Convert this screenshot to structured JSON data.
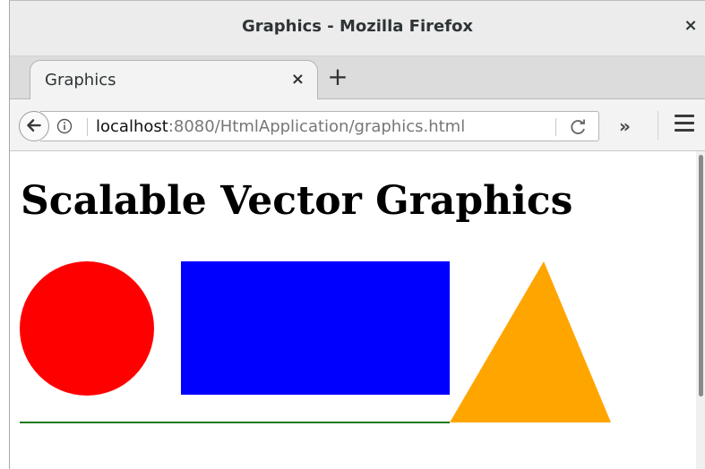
{
  "window": {
    "title": "Graphics - Mozilla Firefox",
    "close_glyph": "×"
  },
  "tabs": [
    {
      "label": "Graphics",
      "close_glyph": "×",
      "active": true
    }
  ],
  "new_tab_glyph": "+",
  "navbar": {
    "url_host": "localhost",
    "url_path": ":8080/HtmlApplication/graphics.html",
    "overflow_glyph": "»",
    "icons": [
      "back-arrow-icon",
      "info-icon",
      "reload-icon",
      "hamburger-menu-icon"
    ]
  },
  "page": {
    "heading": "Scalable Vector Graphics",
    "shapes": {
      "circle_color": "#ff0000",
      "rect_color": "#0000ff",
      "triangle_color": "#ffa500",
      "line_color": "#1f7a1f"
    }
  }
}
